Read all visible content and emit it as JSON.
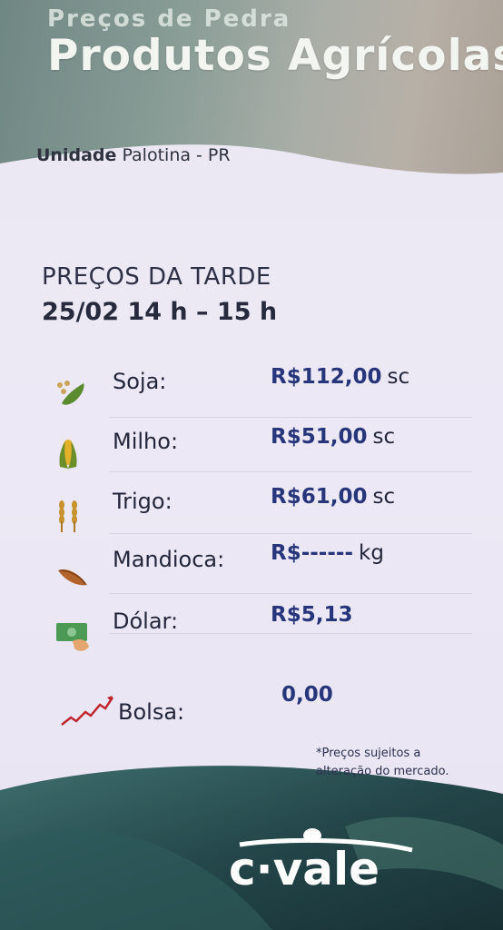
{
  "header": {
    "subtitle": "Preços de Pedra",
    "title": "Produtos Agrícolas"
  },
  "unit": {
    "prefix": "Unidade",
    "name": "Palotina - PR"
  },
  "period": {
    "title": "PREÇOS DA  TARDE",
    "time": "25/02  14 h – 15 h"
  },
  "prices": [
    {
      "icon": "soybean-icon",
      "label": "Soja:",
      "value": "R$112,00",
      "unit": "sc"
    },
    {
      "icon": "corn-icon",
      "label": "Milho:",
      "value": "R$51,00",
      "unit": "sc"
    },
    {
      "icon": "wheat-icon",
      "label": "Trigo:",
      "value": "R$61,00",
      "unit": "sc"
    },
    {
      "icon": "cassava-icon",
      "label": "Mandioca:",
      "value": "R$------",
      "unit": "kg"
    },
    {
      "icon": "dollar-bill-icon",
      "label": "Dólar:",
      "value": "R$5,13",
      "unit": ""
    },
    {
      "icon": "stock-chart-icon",
      "label": "Bolsa:",
      "value": "0,00",
      "unit": ""
    }
  ],
  "note": {
    "line1": "*Preços sujeitos a",
    "line2": "alteração do mercado."
  },
  "logo": {
    "text": "c·vale"
  },
  "colors": {
    "price": "#27357a",
    "header": "#8a9d97",
    "footer": "#1f3a3c"
  }
}
